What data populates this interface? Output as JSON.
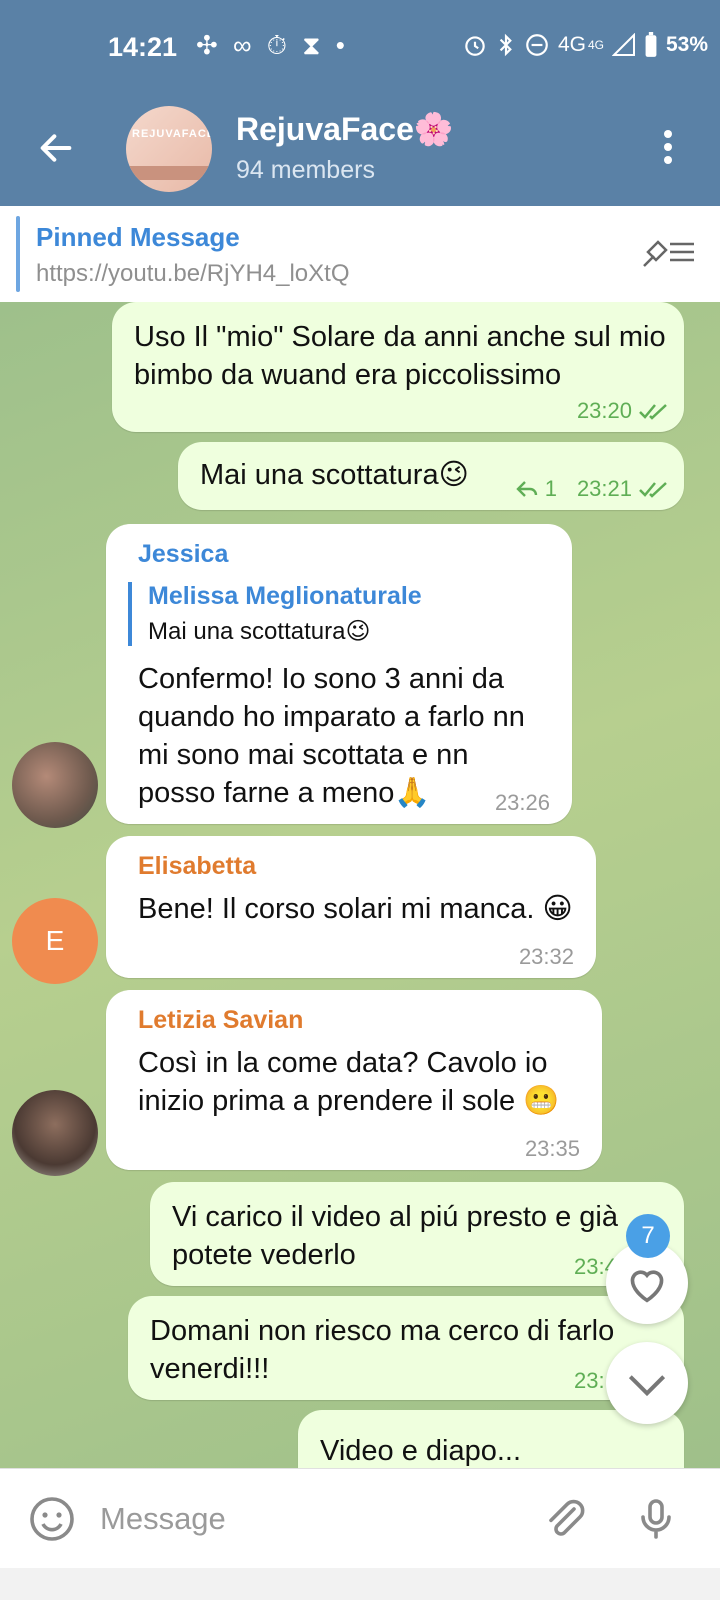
{
  "status_bar": {
    "time": "14:21",
    "left_icons": "✣ ∞ ⏱ ⧗ •",
    "network": "4G",
    "network_sup": "4G",
    "battery": "53%"
  },
  "header": {
    "title": "RejuvaFace🌸",
    "subtitle": "94 members",
    "avatar_text": "REJUVAFACE"
  },
  "pinned": {
    "label": "Pinned Message",
    "text": "https://youtu.be/RjYH4_loXtQ"
  },
  "messages": [
    {
      "type": "out",
      "text": "Uso Il \"mio\" Solare da anni anche sul mio bimbo da wuand era piccolissimo",
      "time": "23:20"
    },
    {
      "type": "out",
      "text": "Mai una scottatura😉",
      "time": "23:21",
      "replies": "1"
    },
    {
      "type": "in",
      "sender": "Jessica",
      "sender_color": "#3d88d8",
      "reply_to": {
        "name": "Melissa Meglionaturale",
        "text": "Mai una scottatura😉"
      },
      "text": "Confermo! Io sono 3 anni da quando ho imparato a farlo nn mi sono mai scottata e nn posso farne a meno🙏",
      "time": "23:26"
    },
    {
      "type": "in",
      "sender": "Elisabetta",
      "sender_color": "#e07b2e",
      "avatar_letter": "E",
      "text": "Bene! Il corso solari mi manca. 😀",
      "time": "23:32"
    },
    {
      "type": "in",
      "sender": "Letizia Savian",
      "sender_color": "#e07b2e",
      "text": "Così in la come data? Cavolo io inizio prima a prendere il sole 😬",
      "time": "23:35"
    },
    {
      "type": "out",
      "text": "Vi carico il video al piú presto e già potete vederlo",
      "time": "23:4"
    },
    {
      "type": "out",
      "text": "Domani non riesco ma cerco di farlo venerdi!!!",
      "time": "23:"
    },
    {
      "type": "out",
      "text": "Video e diapo...",
      "time": ""
    }
  ],
  "fab": {
    "badge_count": "7"
  },
  "composer": {
    "placeholder": "Message"
  },
  "colors": {
    "header_bg": "#5a81a6",
    "outgoing_bubble": "#efffde",
    "incoming_bubble": "#ffffff",
    "accent_blue": "#3d88d8",
    "sender_orange": "#e07b2e"
  }
}
